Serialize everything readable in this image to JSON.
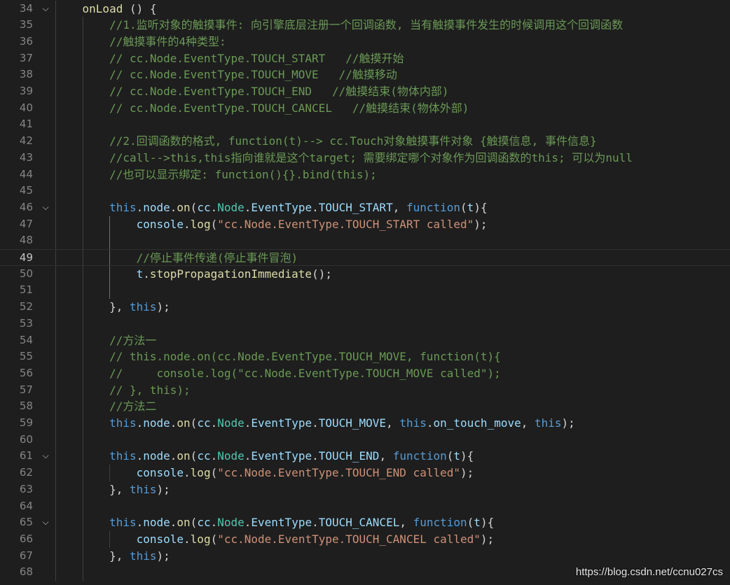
{
  "editor": {
    "lines": [
      {
        "num": "34",
        "fold": true,
        "tokens": [
          [
            "p",
            "    "
          ],
          [
            "fn",
            "onLoad"
          ],
          [
            "p",
            " () {"
          ]
        ]
      },
      {
        "num": "35",
        "tokens": [
          [
            "p",
            "        "
          ],
          [
            "c",
            "//1.监听对象的触摸事件: 向引擎底层注册一个回调函数, 当有触摸事件发生的时候调用这个回调函数"
          ]
        ]
      },
      {
        "num": "36",
        "tokens": [
          [
            "p",
            "        "
          ],
          [
            "c",
            "//触摸事件的4种类型:"
          ]
        ]
      },
      {
        "num": "37",
        "tokens": [
          [
            "p",
            "        "
          ],
          [
            "c",
            "// cc.Node.EventType.TOUCH_START   //触摸开始"
          ]
        ]
      },
      {
        "num": "38",
        "tokens": [
          [
            "p",
            "        "
          ],
          [
            "c",
            "// cc.Node.EventType.TOUCH_MOVE   //触摸移动"
          ]
        ]
      },
      {
        "num": "39",
        "tokens": [
          [
            "p",
            "        "
          ],
          [
            "c",
            "// cc.Node.EventType.TOUCH_END   //触摸结束(物体内部)"
          ]
        ]
      },
      {
        "num": "40",
        "tokens": [
          [
            "p",
            "        "
          ],
          [
            "c",
            "// cc.Node.EventType.TOUCH_CANCEL   //触摸结束(物体外部)"
          ]
        ]
      },
      {
        "num": "41",
        "tokens": []
      },
      {
        "num": "42",
        "tokens": [
          [
            "p",
            "        "
          ],
          [
            "c",
            "//2.回调函数的格式, function(t)--> cc.Touch对象触摸事件对象 {触摸信息, 事件信息}"
          ]
        ]
      },
      {
        "num": "43",
        "tokens": [
          [
            "p",
            "        "
          ],
          [
            "c",
            "//call-->this,this指向谁就是这个target; 需要绑定哪个对象作为回调函数的this; 可以为null"
          ]
        ]
      },
      {
        "num": "44",
        "tokens": [
          [
            "p",
            "        "
          ],
          [
            "c",
            "//也可以显示绑定: function(){}.bind(this);"
          ]
        ]
      },
      {
        "num": "45",
        "tokens": []
      },
      {
        "num": "46",
        "fold": true,
        "tokens": [
          [
            "p",
            "        "
          ],
          [
            "k",
            "this"
          ],
          [
            "p",
            "."
          ],
          [
            "v",
            "node"
          ],
          [
            "p",
            "."
          ],
          [
            "fn",
            "on"
          ],
          [
            "p",
            "("
          ],
          [
            "v",
            "cc"
          ],
          [
            "p",
            "."
          ],
          [
            "t",
            "Node"
          ],
          [
            "p",
            "."
          ],
          [
            "v",
            "EventType"
          ],
          [
            "p",
            "."
          ],
          [
            "v",
            "TOUCH_START"
          ],
          [
            "p",
            ", "
          ],
          [
            "k",
            "function"
          ],
          [
            "p",
            "("
          ],
          [
            "v",
            "t"
          ],
          [
            "p",
            "){"
          ]
        ]
      },
      {
        "num": "47",
        "tokens": [
          [
            "p",
            "            "
          ],
          [
            "v",
            "console"
          ],
          [
            "p",
            "."
          ],
          [
            "fn",
            "log"
          ],
          [
            "p",
            "("
          ],
          [
            "s",
            "\"cc.Node.EventType.TOUCH_START called\""
          ],
          [
            "p",
            ");"
          ]
        ]
      },
      {
        "num": "48",
        "tokens": []
      },
      {
        "num": "49",
        "current": true,
        "tokens": [
          [
            "p",
            "            "
          ],
          [
            "c",
            "//停止事件传递(停止事件冒泡)"
          ]
        ]
      },
      {
        "num": "50",
        "tokens": [
          [
            "p",
            "            "
          ],
          [
            "v",
            "t"
          ],
          [
            "p",
            "."
          ],
          [
            "fn",
            "stopPropagationImmediate"
          ],
          [
            "p",
            "();"
          ]
        ]
      },
      {
        "num": "51",
        "tokens": []
      },
      {
        "num": "52",
        "tokens": [
          [
            "p",
            "        }, "
          ],
          [
            "k",
            "this"
          ],
          [
            "p",
            ");"
          ]
        ]
      },
      {
        "num": "53",
        "tokens": []
      },
      {
        "num": "54",
        "tokens": [
          [
            "p",
            "        "
          ],
          [
            "c",
            "//方法一"
          ]
        ]
      },
      {
        "num": "55",
        "tokens": [
          [
            "p",
            "        "
          ],
          [
            "c",
            "// this.node.on(cc.Node.EventType.TOUCH_MOVE, function(t){"
          ]
        ]
      },
      {
        "num": "56",
        "tokens": [
          [
            "p",
            "        "
          ],
          [
            "c",
            "//     console.log(\"cc.Node.EventType.TOUCH_MOVE called\");"
          ]
        ]
      },
      {
        "num": "57",
        "tokens": [
          [
            "p",
            "        "
          ],
          [
            "c",
            "// }, this);"
          ]
        ]
      },
      {
        "num": "58",
        "tokens": [
          [
            "p",
            "        "
          ],
          [
            "c",
            "//方法二"
          ]
        ]
      },
      {
        "num": "59",
        "tokens": [
          [
            "p",
            "        "
          ],
          [
            "k",
            "this"
          ],
          [
            "p",
            "."
          ],
          [
            "v",
            "node"
          ],
          [
            "p",
            "."
          ],
          [
            "fn",
            "on"
          ],
          [
            "p",
            "("
          ],
          [
            "v",
            "cc"
          ],
          [
            "p",
            "."
          ],
          [
            "t",
            "Node"
          ],
          [
            "p",
            "."
          ],
          [
            "v",
            "EventType"
          ],
          [
            "p",
            "."
          ],
          [
            "v",
            "TOUCH_MOVE"
          ],
          [
            "p",
            ", "
          ],
          [
            "k",
            "this"
          ],
          [
            "p",
            "."
          ],
          [
            "v",
            "on_touch_move"
          ],
          [
            "p",
            ", "
          ],
          [
            "k",
            "this"
          ],
          [
            "p",
            ");"
          ]
        ]
      },
      {
        "num": "60",
        "tokens": []
      },
      {
        "num": "61",
        "fold": true,
        "tokens": [
          [
            "p",
            "        "
          ],
          [
            "k",
            "this"
          ],
          [
            "p",
            "."
          ],
          [
            "v",
            "node"
          ],
          [
            "p",
            "."
          ],
          [
            "fn",
            "on"
          ],
          [
            "p",
            "("
          ],
          [
            "v",
            "cc"
          ],
          [
            "p",
            "."
          ],
          [
            "t",
            "Node"
          ],
          [
            "p",
            "."
          ],
          [
            "v",
            "EventType"
          ],
          [
            "p",
            "."
          ],
          [
            "v",
            "TOUCH_END"
          ],
          [
            "p",
            ", "
          ],
          [
            "k",
            "function"
          ],
          [
            "p",
            "("
          ],
          [
            "v",
            "t"
          ],
          [
            "p",
            "){"
          ]
        ]
      },
      {
        "num": "62",
        "tokens": [
          [
            "p",
            "            "
          ],
          [
            "v",
            "console"
          ],
          [
            "p",
            "."
          ],
          [
            "fn",
            "log"
          ],
          [
            "p",
            "("
          ],
          [
            "s",
            "\"cc.Node.EventType.TOUCH_END called\""
          ],
          [
            "p",
            ");"
          ]
        ]
      },
      {
        "num": "63",
        "tokens": [
          [
            "p",
            "        }, "
          ],
          [
            "k",
            "this"
          ],
          [
            "p",
            ");"
          ]
        ]
      },
      {
        "num": "64",
        "tokens": []
      },
      {
        "num": "65",
        "fold": true,
        "tokens": [
          [
            "p",
            "        "
          ],
          [
            "k",
            "this"
          ],
          [
            "p",
            "."
          ],
          [
            "v",
            "node"
          ],
          [
            "p",
            "."
          ],
          [
            "fn",
            "on"
          ],
          [
            "p",
            "("
          ],
          [
            "v",
            "cc"
          ],
          [
            "p",
            "."
          ],
          [
            "t",
            "Node"
          ],
          [
            "p",
            "."
          ],
          [
            "v",
            "EventType"
          ],
          [
            "p",
            "."
          ],
          [
            "v",
            "TOUCH_CANCEL"
          ],
          [
            "p",
            ", "
          ],
          [
            "k",
            "function"
          ],
          [
            "p",
            "("
          ],
          [
            "v",
            "t"
          ],
          [
            "p",
            "){"
          ]
        ]
      },
      {
        "num": "66",
        "tokens": [
          [
            "p",
            "            "
          ],
          [
            "v",
            "console"
          ],
          [
            "p",
            "."
          ],
          [
            "fn",
            "log"
          ],
          [
            "p",
            "("
          ],
          [
            "s",
            "\"cc.Node.EventType.TOUCH_CANCEL called\""
          ],
          [
            "p",
            ");"
          ]
        ]
      },
      {
        "num": "67",
        "tokens": [
          [
            "p",
            "        }, "
          ],
          [
            "k",
            "this"
          ],
          [
            "p",
            ");"
          ]
        ]
      },
      {
        "num": "68",
        "tokens": []
      }
    ],
    "fold_glyph": "⌵",
    "colors": {
      "background": "#1e1e1e",
      "keyword": "#569cd6",
      "function": "#dcdcaa",
      "variable": "#9cdcfe",
      "type": "#4ec9b0",
      "string": "#ce9178",
      "comment": "#6a9955"
    }
  },
  "watermark": "https://blog.csdn.net/ccnu027cs"
}
